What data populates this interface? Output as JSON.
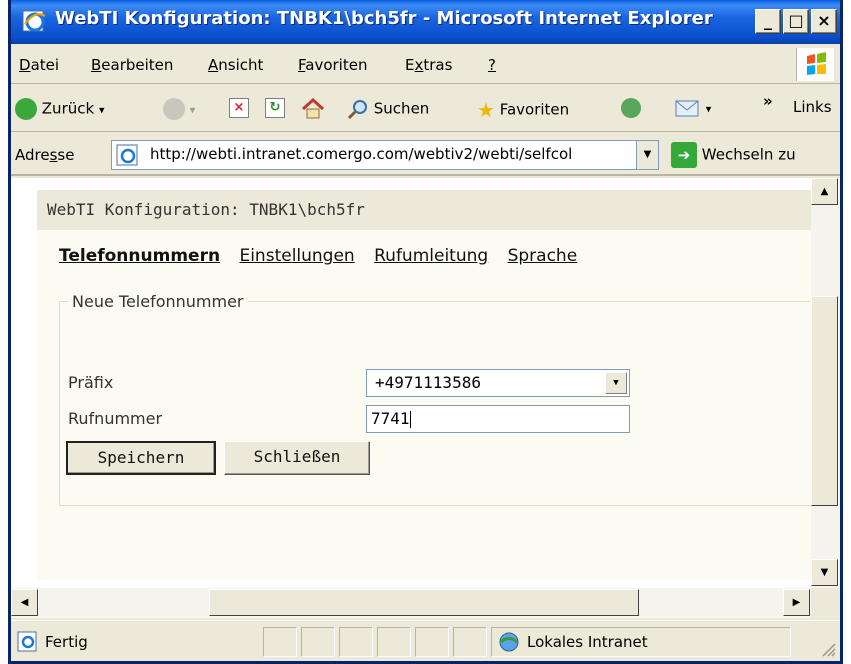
{
  "window": {
    "title": "WebTI Konfiguration: TNBK1\\bch5fr - Microsoft Internet Explorer",
    "minimize_glyph": "_",
    "maximize_glyph": "□",
    "close_glyph": "×"
  },
  "menubar": {
    "items": [
      {
        "first": "D",
        "rest": "atei"
      },
      {
        "first": "B",
        "rest": "earbeiten"
      },
      {
        "first": "A",
        "rest": "nsicht"
      },
      {
        "first": "F",
        "rest": "avoriten"
      },
      {
        "pre": "E",
        "first": "x",
        "rest": "tras"
      },
      {
        "first": "?",
        "rest": ""
      }
    ]
  },
  "toolbar": {
    "back_label": "Zurück",
    "search_label": "Suchen",
    "favorites_label": "Favoriten",
    "links_label": "Links",
    "chevron": "»",
    "dropdown_glyph": "▾"
  },
  "addressbar": {
    "label_pre": "Adre",
    "label_ul": "s",
    "label_post": "se",
    "url": "http://webti.intranet.comergo.com/webtiv2/webti/selfcol",
    "go_label": "Wechseln zu",
    "go_glyph": "➔"
  },
  "page": {
    "header": "WebTI Konfiguration: TNBK1\\bch5fr",
    "tabs": [
      "Telefonnummern",
      "Einstellungen",
      "Rufumleitung",
      "Sprache"
    ],
    "legend": "Neue Telefonnummer",
    "prefix_label": "Präfix",
    "prefix_value": "+4971113586",
    "number_label": "Rufnummer",
    "number_value": "7741",
    "save_label": "Speichern",
    "close_label": "Schließen"
  },
  "statusbar": {
    "status": "Fertig",
    "zone": "Lokales Intranet"
  },
  "icons": {
    "up": "▲",
    "down": "▼",
    "left": "◀",
    "right": "▶"
  },
  "colors": {
    "titlebar_blue": "#0a4fcd",
    "chrome": "#ece9d8",
    "page_header_bg": "#ede9da",
    "page_body_bg": "#fbfbf1"
  }
}
